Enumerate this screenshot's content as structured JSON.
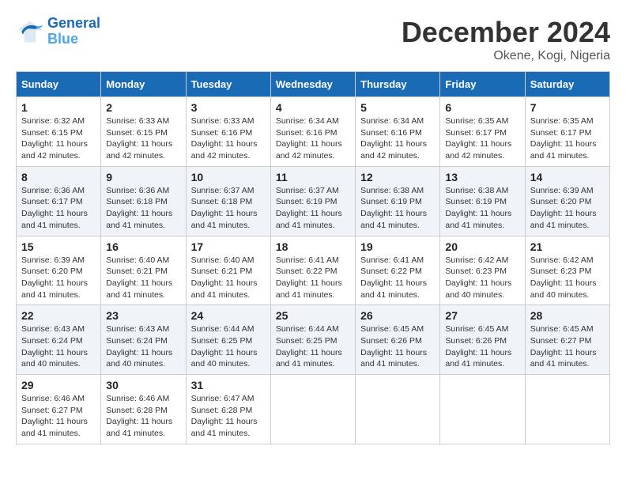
{
  "header": {
    "logo_general": "General",
    "logo_blue": "Blue",
    "month_year": "December 2024",
    "location": "Okene, Kogi, Nigeria"
  },
  "days_of_week": [
    "Sunday",
    "Monday",
    "Tuesday",
    "Wednesday",
    "Thursday",
    "Friday",
    "Saturday"
  ],
  "weeks": [
    [
      {
        "day": 1,
        "info": "Sunrise: 6:32 AM\nSunset: 6:15 PM\nDaylight: 11 hours\nand 42 minutes."
      },
      {
        "day": 2,
        "info": "Sunrise: 6:33 AM\nSunset: 6:15 PM\nDaylight: 11 hours\nand 42 minutes."
      },
      {
        "day": 3,
        "info": "Sunrise: 6:33 AM\nSunset: 6:16 PM\nDaylight: 11 hours\nand 42 minutes."
      },
      {
        "day": 4,
        "info": "Sunrise: 6:34 AM\nSunset: 6:16 PM\nDaylight: 11 hours\nand 42 minutes."
      },
      {
        "day": 5,
        "info": "Sunrise: 6:34 AM\nSunset: 6:16 PM\nDaylight: 11 hours\nand 42 minutes."
      },
      {
        "day": 6,
        "info": "Sunrise: 6:35 AM\nSunset: 6:17 PM\nDaylight: 11 hours\nand 42 minutes."
      },
      {
        "day": 7,
        "info": "Sunrise: 6:35 AM\nSunset: 6:17 PM\nDaylight: 11 hours\nand 41 minutes."
      }
    ],
    [
      {
        "day": 8,
        "info": "Sunrise: 6:36 AM\nSunset: 6:17 PM\nDaylight: 11 hours\nand 41 minutes."
      },
      {
        "day": 9,
        "info": "Sunrise: 6:36 AM\nSunset: 6:18 PM\nDaylight: 11 hours\nand 41 minutes."
      },
      {
        "day": 10,
        "info": "Sunrise: 6:37 AM\nSunset: 6:18 PM\nDaylight: 11 hours\nand 41 minutes."
      },
      {
        "day": 11,
        "info": "Sunrise: 6:37 AM\nSunset: 6:19 PM\nDaylight: 11 hours\nand 41 minutes."
      },
      {
        "day": 12,
        "info": "Sunrise: 6:38 AM\nSunset: 6:19 PM\nDaylight: 11 hours\nand 41 minutes."
      },
      {
        "day": 13,
        "info": "Sunrise: 6:38 AM\nSunset: 6:19 PM\nDaylight: 11 hours\nand 41 minutes."
      },
      {
        "day": 14,
        "info": "Sunrise: 6:39 AM\nSunset: 6:20 PM\nDaylight: 11 hours\nand 41 minutes."
      }
    ],
    [
      {
        "day": 15,
        "info": "Sunrise: 6:39 AM\nSunset: 6:20 PM\nDaylight: 11 hours\nand 41 minutes."
      },
      {
        "day": 16,
        "info": "Sunrise: 6:40 AM\nSunset: 6:21 PM\nDaylight: 11 hours\nand 41 minutes."
      },
      {
        "day": 17,
        "info": "Sunrise: 6:40 AM\nSunset: 6:21 PM\nDaylight: 11 hours\nand 41 minutes."
      },
      {
        "day": 18,
        "info": "Sunrise: 6:41 AM\nSunset: 6:22 PM\nDaylight: 11 hours\nand 41 minutes."
      },
      {
        "day": 19,
        "info": "Sunrise: 6:41 AM\nSunset: 6:22 PM\nDaylight: 11 hours\nand 41 minutes."
      },
      {
        "day": 20,
        "info": "Sunrise: 6:42 AM\nSunset: 6:23 PM\nDaylight: 11 hours\nand 40 minutes."
      },
      {
        "day": 21,
        "info": "Sunrise: 6:42 AM\nSunset: 6:23 PM\nDaylight: 11 hours\nand 40 minutes."
      }
    ],
    [
      {
        "day": 22,
        "info": "Sunrise: 6:43 AM\nSunset: 6:24 PM\nDaylight: 11 hours\nand 40 minutes."
      },
      {
        "day": 23,
        "info": "Sunrise: 6:43 AM\nSunset: 6:24 PM\nDaylight: 11 hours\nand 40 minutes."
      },
      {
        "day": 24,
        "info": "Sunrise: 6:44 AM\nSunset: 6:25 PM\nDaylight: 11 hours\nand 40 minutes."
      },
      {
        "day": 25,
        "info": "Sunrise: 6:44 AM\nSunset: 6:25 PM\nDaylight: 11 hours\nand 41 minutes."
      },
      {
        "day": 26,
        "info": "Sunrise: 6:45 AM\nSunset: 6:26 PM\nDaylight: 11 hours\nand 41 minutes."
      },
      {
        "day": 27,
        "info": "Sunrise: 6:45 AM\nSunset: 6:26 PM\nDaylight: 11 hours\nand 41 minutes."
      },
      {
        "day": 28,
        "info": "Sunrise: 6:45 AM\nSunset: 6:27 PM\nDaylight: 11 hours\nand 41 minutes."
      }
    ],
    [
      {
        "day": 29,
        "info": "Sunrise: 6:46 AM\nSunset: 6:27 PM\nDaylight: 11 hours\nand 41 minutes."
      },
      {
        "day": 30,
        "info": "Sunrise: 6:46 AM\nSunset: 6:28 PM\nDaylight: 11 hours\nand 41 minutes."
      },
      {
        "day": 31,
        "info": "Sunrise: 6:47 AM\nSunset: 6:28 PM\nDaylight: 11 hours\nand 41 minutes."
      },
      null,
      null,
      null,
      null
    ]
  ]
}
